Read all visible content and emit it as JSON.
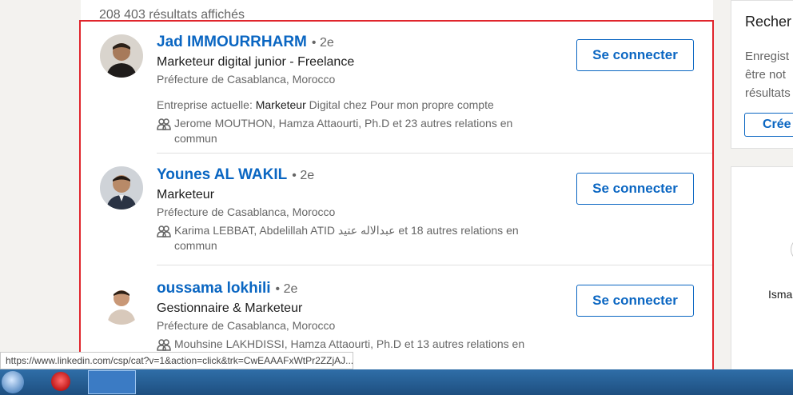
{
  "results": {
    "count_text": "208 403 résultats affichés",
    "items": [
      {
        "name": "Jad IMMOURRHARM",
        "degree": "• 2e",
        "headline": "Marketeur digital junior - Freelance",
        "location": "Préfecture de Casablanca, Morocco",
        "current_prefix": "Entreprise actuelle:",
        "current_strong": "Marketeur",
        "current_rest": "Digital chez Pour mon propre compte",
        "shared_text": "Jerome MOUTHON, Hamza Attaourti, Ph.D et 23 autres relations en commun",
        "connect_label": "Se connecter"
      },
      {
        "name": "Younes AL WAKIL",
        "degree": "• 2e",
        "headline": "Marketeur",
        "location": "Préfecture de Casablanca, Morocco",
        "shared_text": "Karima LEBBAT, Abdelillah ATID عبدالاله عتيد et 18 autres relations en commun",
        "connect_label": "Se connecter"
      },
      {
        "name": "oussama lokhili",
        "degree": "• 2e",
        "headline": "Gestionnaire & Marketeur",
        "location": "Préfecture de Casablanca, Morocco",
        "shared_text": "Mouhsine LAKHDISSI, Hamza Attaourti, Ph.D et 13 autres relations en",
        "connect_label": "Se connecter"
      }
    ]
  },
  "sidebar": {
    "title": "Recher",
    "desc_lines": [
      "Enregist",
      "être not",
      "résultats"
    ],
    "create_label": "Crée",
    "person_partial": "Isma"
  },
  "status_bar": {
    "url": "https://www.linkedin.com/csp/cat?v=1&action=click&trk=CwEAAAFxWtPr2ZZjAJ..."
  },
  "colors": {
    "accent": "#0a66c2",
    "selection": "#e0252c"
  },
  "icons": {
    "shared": "people-icon"
  }
}
